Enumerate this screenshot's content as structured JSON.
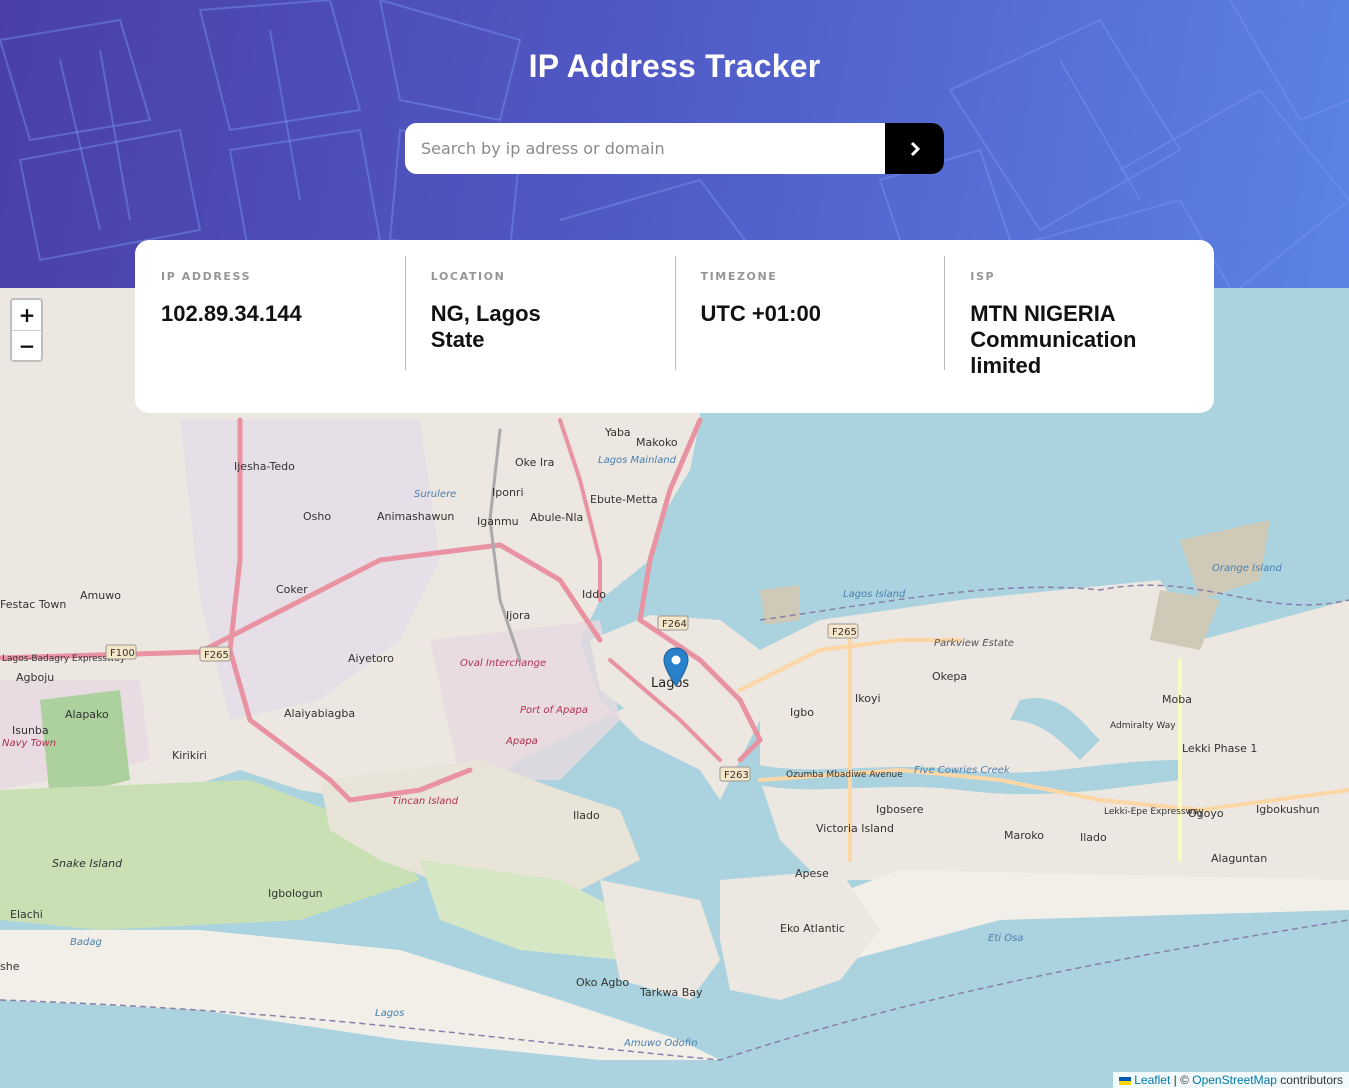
{
  "app": {
    "title": "IP Address Tracker"
  },
  "search": {
    "placeholder": "Search by ip adress or domain",
    "value": "",
    "button_icon": "chevron-right-icon"
  },
  "info": {
    "ip": {
      "label": "IP ADDRESS",
      "value": "102.89.34.144"
    },
    "location": {
      "label": "LOCATION",
      "value": "NG, Lagos State"
    },
    "timezone": {
      "label": "TIMEZONE",
      "value": "UTC +01:00"
    },
    "isp": {
      "label": "ISP",
      "value": "MTN NIGERIA Communication limited"
    }
  },
  "map": {
    "zoom_in": "+",
    "zoom_out": "−",
    "marker_icon": "map-pin-icon",
    "attribution": {
      "leaflet": "Leaflet",
      "separator": " | © ",
      "osm": "OpenStreetMap",
      "suffix": " contributors"
    },
    "labels": {
      "lagos": "Lagos",
      "yaba": "Yaba",
      "makoko": "Makoko",
      "lagos_mainland": "Lagos Mainland",
      "oke_ira": "Oke Ira",
      "ijesha_tedo": "Ijesha-Tedo",
      "surulere": "Surulere",
      "iponri": "Iponri",
      "ebute_metta": "Ebute-Metta",
      "osho": "Osho",
      "animashawun": "Animashawun",
      "iganmu": "Iganmu",
      "abule_nla": "Abule-Nla",
      "coker": "Coker",
      "amuwo": "Amuwo",
      "festac_town": "Festac Town",
      "ijora": "Ijora",
      "iddo": "Iddo",
      "aiyetoro": "Aiyetoro",
      "agboju": "Agboju",
      "alapako": "Alapako",
      "alaiyabiagba": "Alaiyabiagba",
      "isunba": "Isunba",
      "navy_town": "Navy Town",
      "kirikiri": "Kirikiri",
      "oval_interchange": "Oval Interchange",
      "port_of_apapa": "Port of Apapa",
      "apapa": "Apapa",
      "tincan_island": "Tincan Island",
      "ilado": "Ilado",
      "snake_island": "Snake Island",
      "igbologun": "Igbologun",
      "elachi": "Elachi",
      "oko_agbo": "Oko Agbo",
      "tarkwa_bay": "Tarkwa Bay",
      "eko_atlantic": "Eko Atlantic",
      "victoria_island": "Victoria Island",
      "apese": "Apese",
      "ikoyi": "Ikoyi",
      "igbo": "Igbo",
      "okepa": "Okepa",
      "parkview_estate": "Parkview Estate",
      "igbosere": "Igbosere",
      "maroko": "Maroko",
      "ilado2": "Ilado",
      "lekki_phase": "Lekki Phase 1",
      "moba": "Moba",
      "ogoyo": "Ogoyo",
      "igbokushun": "Igbokushun",
      "alaguntan": "Alaguntan",
      "orange_island": "Orange Island",
      "lagos_island": "Lagos Island",
      "five_cowries_creek": "Five Cowries Creek",
      "f264": "F264",
      "f265": "F265",
      "f263": "F263",
      "f100": "F100",
      "lagos_badagry_expressway": "Lagos-Badagry Expressway",
      "ozumba_mbadiwe_avenue": "Ozumba Mbadiwe Avenue",
      "lekki_epe_expressway": "Lekki-Epe Expressway",
      "admiralty_way": "Admiralty Way",
      "eti_osa": "Eti Osa",
      "amuwo_odofin": "Amuwo Odofin",
      "lagos_water": "Lagos",
      "ishe": "she",
      "badag": "Badag"
    }
  }
}
